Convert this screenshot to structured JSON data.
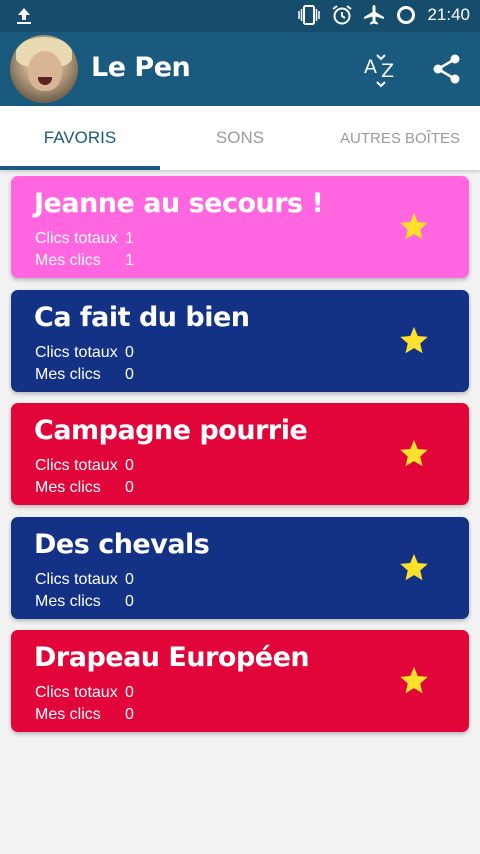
{
  "status_bar": {
    "time": "21:40",
    "icons": [
      "upload-icon",
      "vibrate-icon",
      "alarm-icon",
      "airplane-icon",
      "sync-icon"
    ]
  },
  "app_bar": {
    "title": "Le Pen",
    "sort_icon": "sort-az-icon",
    "share_icon": "share-icon"
  },
  "tabs": [
    {
      "label": "FAVORIS",
      "active": true
    },
    {
      "label": "SONS",
      "active": false
    },
    {
      "label": "AUTRES BOÎTES",
      "active": false
    }
  ],
  "labels": {
    "total_clicks": "Clics totaux",
    "my_clicks": "Mes clics"
  },
  "cards": [
    {
      "title": "Jeanne au secours !",
      "total": "1",
      "mine": "1",
      "color": "#ff66e0",
      "favorite": true
    },
    {
      "title": "Ca fait du bien",
      "total": "0",
      "mine": "0",
      "color": "#143285",
      "favorite": true
    },
    {
      "title": "Campagne pourrie",
      "total": "0",
      "mine": "0",
      "color": "#e2053a",
      "favorite": true
    },
    {
      "title": "Des chevals",
      "total": "0",
      "mine": "0",
      "color": "#143285",
      "favorite": true
    },
    {
      "title": "Drapeau Européen",
      "total": "0",
      "mine": "0",
      "color": "#e2053a",
      "favorite": true
    }
  ],
  "colors": {
    "status_bar": "#174d6c",
    "app_bar": "#1a5a7f",
    "star": "#ffe02a"
  }
}
